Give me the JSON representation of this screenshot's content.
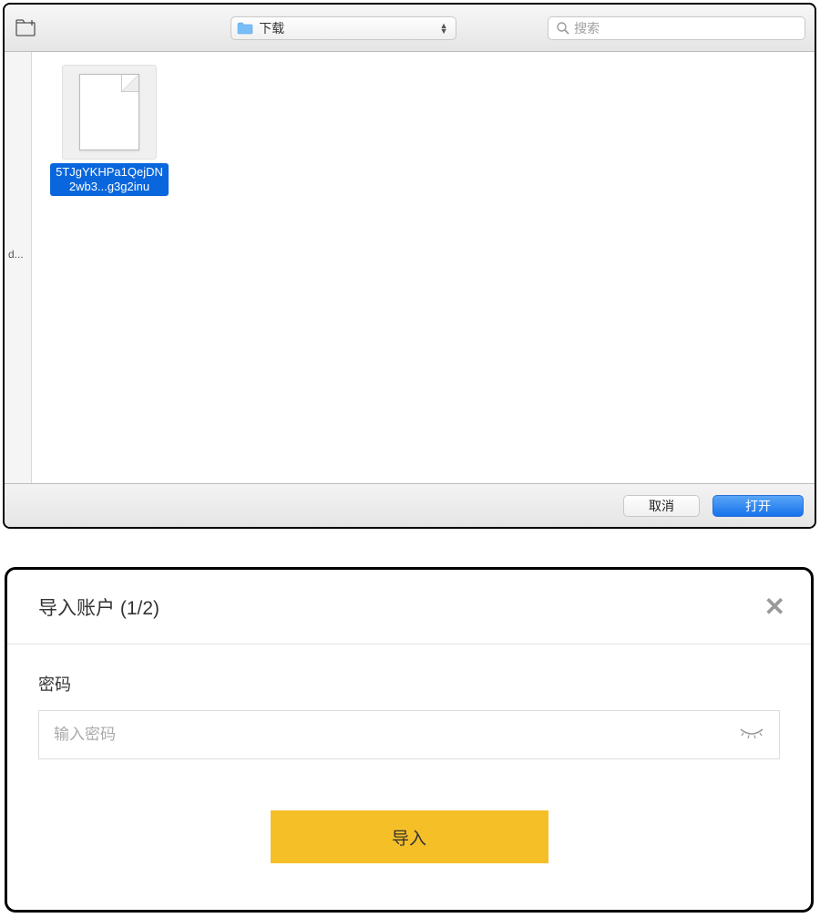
{
  "filePicker": {
    "folderSelect": {
      "label": "下载"
    },
    "search": {
      "placeholder": "搜索"
    },
    "sidebar": {
      "truncated": "d..."
    },
    "files": [
      {
        "name": "5TJgYKHPa1QejDN2wb3...g3g2inu"
      }
    ],
    "buttons": {
      "cancel": "取消",
      "open": "打开"
    }
  },
  "importDialog": {
    "title": "导入账户 (1/2)",
    "passwordLabel": "密码",
    "passwordPlaceholder": "输入密码",
    "importButton": "导入"
  }
}
